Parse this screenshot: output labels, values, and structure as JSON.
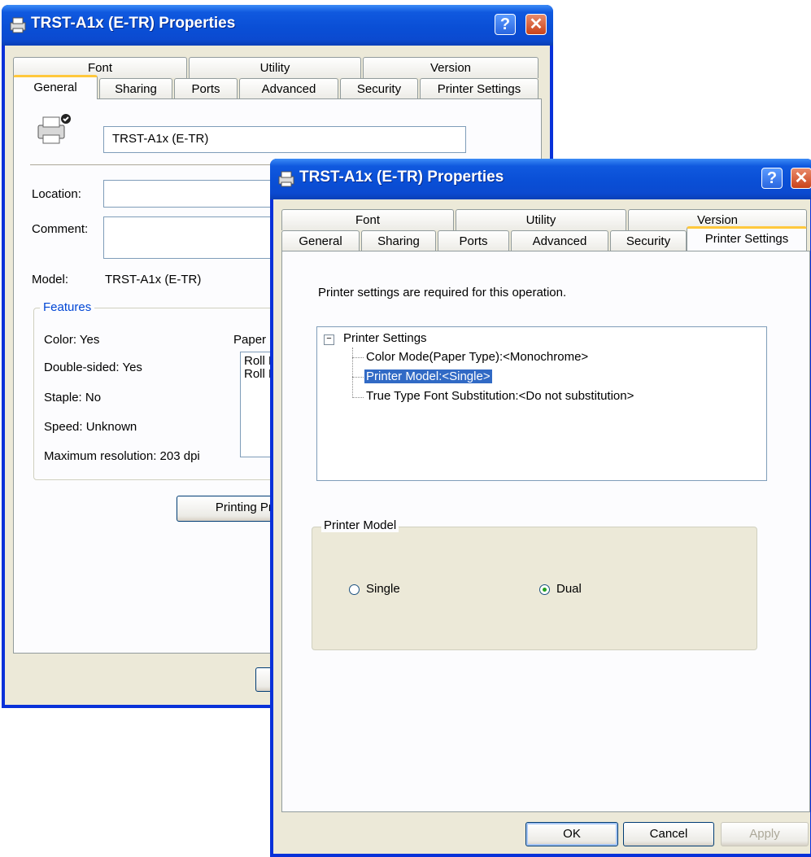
{
  "back_window": {
    "title": "TRST-A1x (E-TR) Properties",
    "tabs_row1": [
      "Font",
      "Utility",
      "Version"
    ],
    "tabs_row2": [
      "General",
      "Sharing",
      "Ports",
      "Advanced",
      "Security",
      "Printer Settings"
    ],
    "printer_name": "TRST-A1x (E-TR)",
    "location_label": "Location:",
    "comment_label": "Comment:",
    "model_label": "Model:",
    "model_value": "TRST-A1x (E-TR)",
    "features_legend": "Features",
    "features": [
      "Color: Yes",
      "Double-sided: Yes",
      "Staple: No",
      "Speed: Unknown",
      "Maximum resolution: 203 dpi"
    ],
    "paper_label": "Paper",
    "paper_items": [
      "Roll P",
      "Roll P"
    ],
    "printing_prefs_button": "Printing Prefere"
  },
  "front_window": {
    "title": "TRST-A1x (E-TR) Properties",
    "tabs_row1": [
      "Font",
      "Utility",
      "Version"
    ],
    "tabs_row2": [
      "General",
      "Sharing",
      "Ports",
      "Advanced",
      "Security",
      "Printer Settings"
    ],
    "notice": "Printer settings are required for this operation.",
    "tree": {
      "root": "Printer Settings",
      "expander": "−",
      "items": [
        "Color Mode(Paper Type):<Monochrome>",
        "Printer Model:<Single>",
        "True Type Font Substitution:<Do not substitution>"
      ],
      "selected_index": 1
    },
    "group_title": "Printer Model",
    "radio_single": "Single",
    "radio_dual": "Dual",
    "selected_radio": "Dual",
    "ok": "OK",
    "cancel": "Cancel",
    "apply": "Apply"
  },
  "title_buttons": {
    "help": "?",
    "close": "✕"
  },
  "colors": {
    "xp_blue": "#0831d9",
    "tab_highlight": "#ffc83c",
    "selection": "#316ac5",
    "dialog_bg": "#ece9d8"
  }
}
